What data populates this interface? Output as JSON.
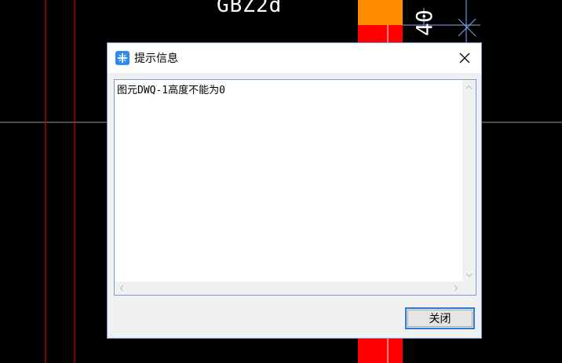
{
  "cad": {
    "label_gbz": "GBZ2d",
    "label_rot": "40"
  },
  "dialog": {
    "title": "提示信息",
    "message": "图元DWQ-1高度不能为0",
    "close_button": "关闭"
  },
  "colors": {
    "background": "#000000",
    "red_line": "#ff0000",
    "grid_line": "#9a9a9a",
    "orange_block": "#ff8c00",
    "red_block": "#ff0000",
    "cyan_line": "#7fb0ff",
    "accent": "#2a7fd4"
  },
  "icons": {
    "app": "app-logo-icon",
    "close": "close-icon"
  }
}
